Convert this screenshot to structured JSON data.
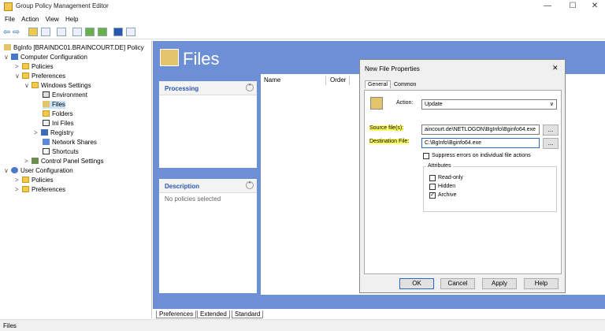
{
  "window": {
    "title": "Group Policy Management Editor",
    "minimize": "—",
    "maximize": "☐",
    "close": "✕"
  },
  "menu": [
    "File",
    "Action",
    "View",
    "Help"
  ],
  "tree": {
    "root": "BgInfo [BRAINDC01.BRAINCOURT.DE] Policy",
    "computer_config": "Computer Configuration",
    "cc_policies": "Policies",
    "cc_preferences": "Preferences",
    "windows_settings": "Windows Settings",
    "environment": "Environment",
    "files": "Files",
    "folders": "Folders",
    "ini_files": "Ini Files",
    "registry": "Registry",
    "network_shares": "Network Shares",
    "shortcuts": "Shortcuts",
    "control_panel": "Control Panel Settings",
    "user_config": "User Configuration",
    "uc_policies": "Policies",
    "uc_preferences": "Preferences"
  },
  "main": {
    "title": "Files",
    "processing": "Processing",
    "description": "Description",
    "no_policies": "No policies selected",
    "col_name": "Name",
    "col_order": "Order"
  },
  "dialog": {
    "title": "New File Properties",
    "close": "✕",
    "tab_general": "General",
    "tab_common": "Common",
    "action_label": "Action:",
    "action_value": "Update",
    "source_label": "Source file(s):",
    "source_value": "aincourt.de\\NETLOGON\\BgInfo\\Bginfo64.exe",
    "dest_label": "Destination File:",
    "dest_value": "C:\\BgInfo\\Bginfo64.exe",
    "browse": "...",
    "suppress": "Suppress errors on individual file actions",
    "attributes": "Attributes",
    "readonly": "Read-only",
    "hidden": "Hidden",
    "archive": "Archive",
    "ok": "OK",
    "cancel": "Cancel",
    "apply": "Apply",
    "help": "Help"
  },
  "tabs": [
    "Preferences",
    "Extended",
    "Standard"
  ],
  "status": "Files"
}
